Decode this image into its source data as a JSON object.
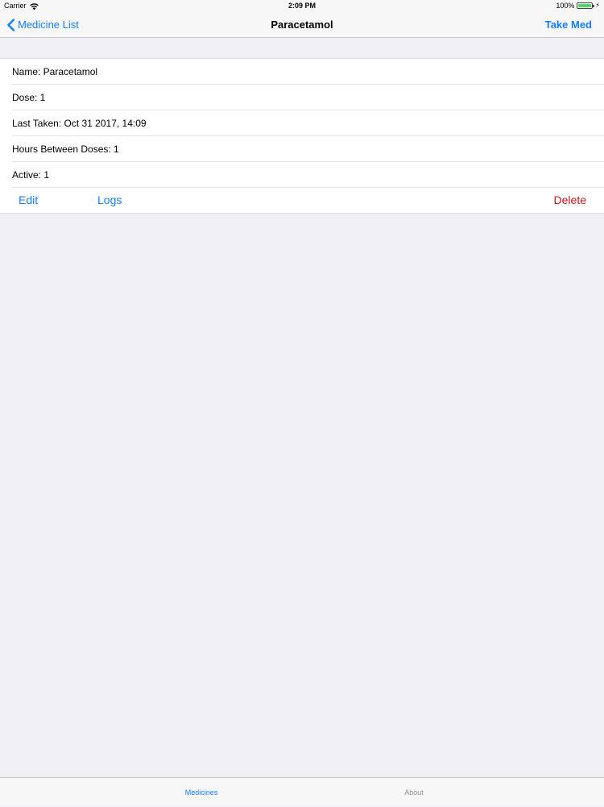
{
  "status_bar": {
    "carrier": "Carrier",
    "time": "2:09 PM",
    "battery": "100%"
  },
  "nav": {
    "back_label": "Medicine List",
    "title": "Paracetamol",
    "right_label": "Take Med"
  },
  "details": {
    "rows": [
      "Name: Paracetamol",
      "Dose: 1",
      "Last Taken: Oct 31 2017, 14:09",
      "Hours Between Doses: 1",
      "Active: 1"
    ],
    "actions": {
      "edit": "Edit",
      "logs": "Logs",
      "delete": "Delete"
    }
  },
  "tabs": [
    {
      "label": "Medicines",
      "selected": true
    },
    {
      "label": "About",
      "selected": false
    }
  ],
  "colors": {
    "accent": "#147efb",
    "destructive": "#d0161f",
    "background": "#efeff4",
    "battery": "#4cd964"
  }
}
